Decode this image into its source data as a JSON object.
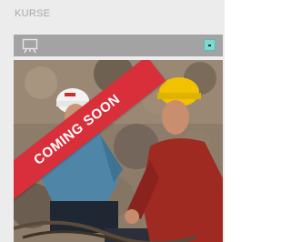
{
  "panel": {
    "title": "KURSE"
  },
  "course_bar": {
    "icon": "presentation-icon",
    "toggle_icon": "dropdown-toggle-icon"
  },
  "course_card": {
    "ribbon_text": "COMING SOON",
    "ribbon_color": "#d92f3a"
  }
}
